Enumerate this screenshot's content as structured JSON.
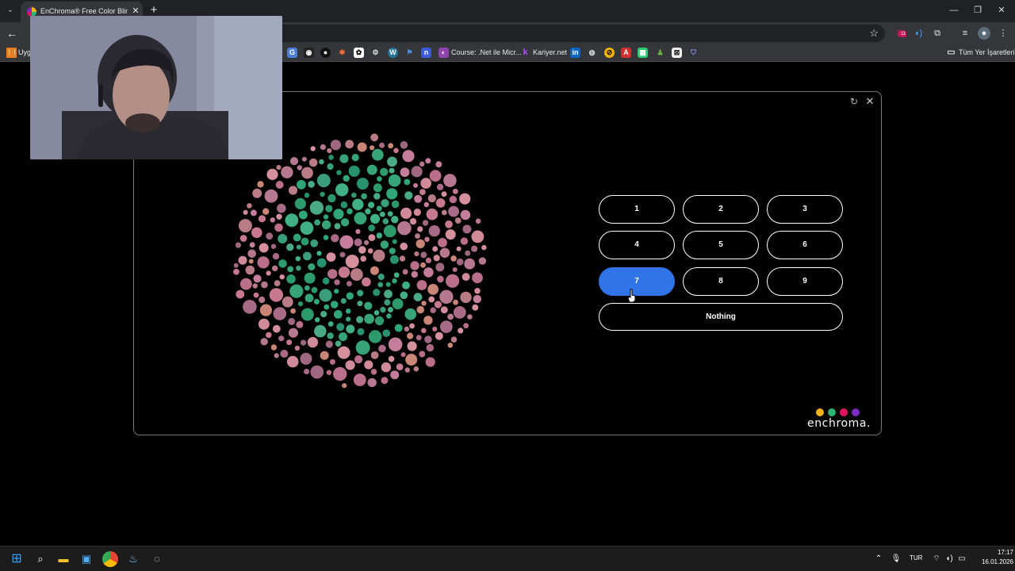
{
  "browser": {
    "active_tab_title": "EnChroma® Free Color Blind Te",
    "bookmarks_left_label": "Uyg",
    "bookmarks": [
      {
        "label": "Course: .Net ile Micr..."
      },
      {
        "label": "Kariyer.net"
      }
    ],
    "all_bookmarks_label": "Tüm Yer İşaretleri",
    "extension_badge": "11"
  },
  "test": {
    "answers": [
      "1",
      "2",
      "3",
      "4",
      "5",
      "6",
      "7",
      "8",
      "9"
    ],
    "selected_answer": "7",
    "nothing_label": "Nothing",
    "plate_hidden_digit_color": "#2fa57a",
    "plate_background_color": "#c5788f"
  },
  "brand": {
    "logo_text": "enchroma.",
    "dot_colors": [
      "#f6b21b",
      "#2bb673",
      "#e4145f",
      "#7b2cbf"
    ]
  },
  "taskbar": {
    "language": "TUR",
    "time": "17:17",
    "date": "16.01.2026"
  }
}
